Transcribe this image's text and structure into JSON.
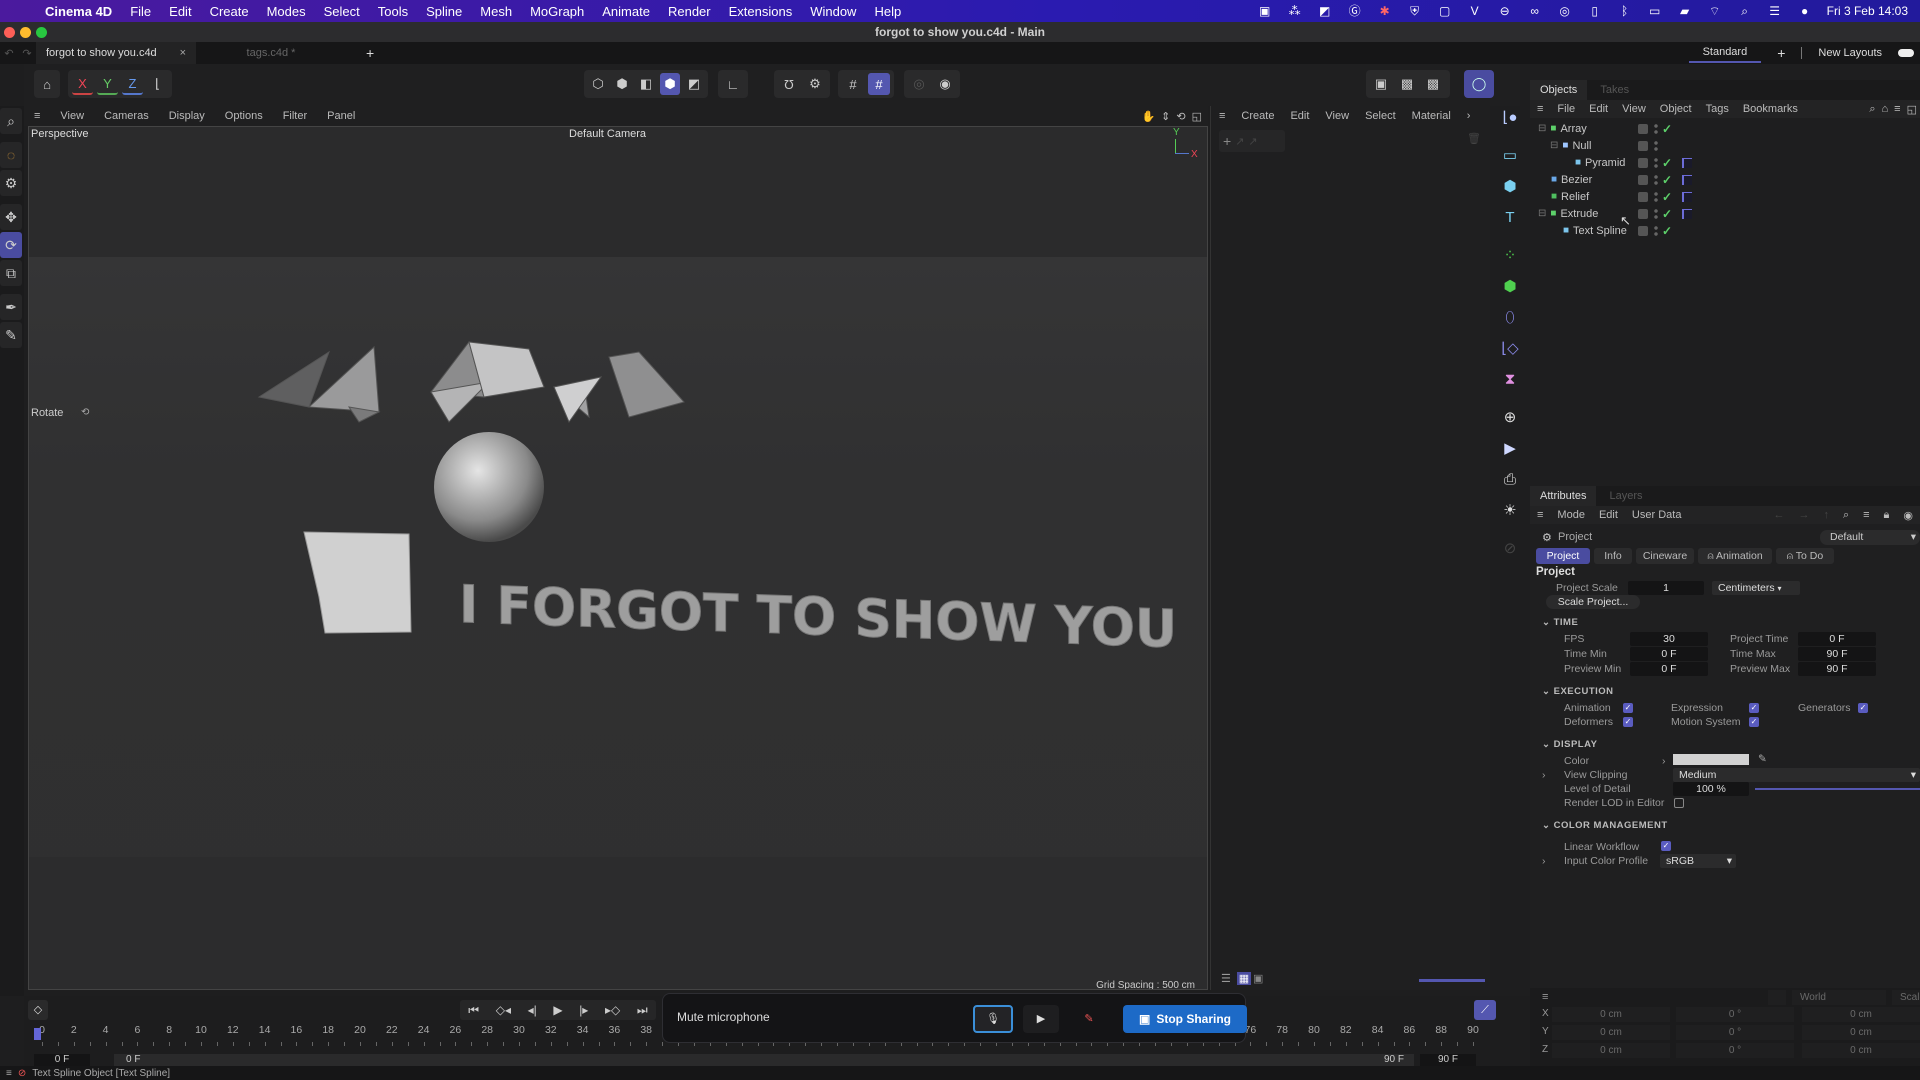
{
  "menubar": {
    "app_name": "Cinema 4D",
    "items": [
      "File",
      "Edit",
      "Create",
      "Modes",
      "Select",
      "Tools",
      "Spline",
      "Mesh",
      "MoGraph",
      "Animate",
      "Render",
      "Extensions",
      "Window",
      "Help"
    ],
    "clock": "Fri 3 Feb  14:03",
    "tray_icons": [
      "screen-record-icon",
      "people-icon",
      "dropbox-icon",
      "grammarly-icon",
      "dropbox-badge-icon",
      "vpn-icon",
      "display-icon",
      "v-icon",
      "teamviewer-icon",
      "creative-cloud-icon",
      "sync-icon",
      "battery-small-icon",
      "bluetooth-icon",
      "screen-mirror-icon",
      "battery-icon",
      "wifi-icon",
      "spotlight-icon",
      "control-center-icon",
      "siri-icon"
    ]
  },
  "window": {
    "title": "forgot to show you.c4d - Main"
  },
  "tabs": [
    {
      "label": "forgot to show you.c4d",
      "active": true
    },
    {
      "label": "tags.c4d *",
      "active": false
    }
  ],
  "new_tab_label": "+",
  "layouts": {
    "current": "Standard",
    "add": "+",
    "new_layouts": "New Layouts"
  },
  "viewport": {
    "menu": [
      "View",
      "Cameras",
      "Display",
      "Options",
      "Filter",
      "Panel"
    ],
    "view_name": "Perspective",
    "camera": "Default Camera",
    "tool_hint": "Rotate",
    "scene_text": "I FORGOT TO SHOW YOU",
    "grid_spacing": "Grid Spacing : 500 cm",
    "axis_labels": {
      "y": "Y",
      "x": "X"
    }
  },
  "axis_toggles": [
    "X",
    "Y",
    "Z"
  ],
  "material_panel": {
    "menu": [
      "Create",
      "Edit",
      "View",
      "Select",
      "Material"
    ],
    "more": "›"
  },
  "objects_panel": {
    "tabs": [
      {
        "label": "Objects",
        "active": true
      },
      {
        "label": "Takes",
        "active": false
      }
    ],
    "menu": [
      "File",
      "Edit",
      "View",
      "Object",
      "Tags",
      "Bookmarks"
    ],
    "objects": [
      {
        "name": "Array",
        "depth": 0,
        "icon": "array-icon",
        "expanded": true,
        "enabled": true,
        "tag": false,
        "color": "#5dd06a"
      },
      {
        "name": "Null",
        "depth": 1,
        "icon": "null-icon",
        "expanded": true,
        "enabled": false,
        "tag": false,
        "color": "#9fc6ff"
      },
      {
        "name": "Pyramid",
        "depth": 2,
        "icon": "pyramid-icon",
        "expanded": false,
        "enabled": true,
        "tag": true,
        "color": "#7cc5ec"
      },
      {
        "name": "Bezier",
        "depth": 0,
        "icon": "bezier-icon",
        "expanded": false,
        "enabled": true,
        "tag": true,
        "color": "#6aa8e8"
      },
      {
        "name": "Relief",
        "depth": 0,
        "icon": "relief-icon",
        "expanded": false,
        "enabled": true,
        "tag": true,
        "color": "#4fbf5f"
      },
      {
        "name": "Extrude",
        "depth": 0,
        "icon": "extrude-icon",
        "expanded": true,
        "enabled": true,
        "tag": true,
        "color": "#5dd06a"
      },
      {
        "name": "Text Spline",
        "depth": 1,
        "icon": "text-spline-icon",
        "expanded": false,
        "enabled": true,
        "tag": false,
        "color": "#7cc5ec"
      }
    ]
  },
  "attributes": {
    "tabs": [
      {
        "label": "Attributes",
        "active": true
      },
      {
        "label": "Layers",
        "active": false
      }
    ],
    "menu": [
      "Mode",
      "Edit",
      "User Data"
    ],
    "object_label": "Project",
    "preset": "Default",
    "subtabs": [
      {
        "label": "Project",
        "active": true
      },
      {
        "label": "Info",
        "active": false
      },
      {
        "label": "Cineware",
        "active": false
      },
      {
        "label": "Animation",
        "active": false,
        "icon": "bell-icon"
      },
      {
        "label": "To Do",
        "active": false,
        "icon": "bell-icon"
      }
    ],
    "section_title": "Project",
    "project_scale_label": "Project Scale",
    "project_scale": "1",
    "project_scale_unit": "Centimeters",
    "scale_project_button": "Scale Project...",
    "time": {
      "title": "TIME",
      "fps_label": "FPS",
      "fps": "30",
      "project_time_label": "Project Time",
      "project_time": "0 F",
      "time_min_label": "Time Min",
      "time_min": "0 F",
      "time_max_label": "Time Max",
      "time_max": "90 F",
      "preview_min_label": "Preview Min",
      "preview_min": "0 F",
      "preview_max_label": "Preview Max",
      "preview_max": "90 F"
    },
    "execution": {
      "title": "EXECUTION",
      "items": [
        {
          "label": "Animation",
          "checked": true
        },
        {
          "label": "Expression",
          "checked": true
        },
        {
          "label": "Generators",
          "checked": true
        },
        {
          "label": "Deformers",
          "checked": true
        },
        {
          "label": "Motion System",
          "checked": true
        }
      ]
    },
    "display": {
      "title": "DISPLAY",
      "color_label": "Color",
      "color_value": "#d2d2d2",
      "view_clipping_label": "View Clipping",
      "view_clipping": "Medium",
      "lod_label": "Level of Detail",
      "lod": "100 %",
      "lod_fraction": 1.0,
      "render_lod_label": "Render LOD in Editor",
      "render_lod": false
    },
    "color_management": {
      "title": "COLOR MANAGEMENT",
      "linear_workflow_label": "Linear Workflow",
      "linear_workflow": true,
      "input_profile_label": "Input Color Profile",
      "input_profile": "sRGB"
    }
  },
  "coordinates": {
    "space": "World",
    "mode": "Scale",
    "rows": [
      {
        "axis": "X",
        "pos": "0 cm",
        "rot": "0 °",
        "scale": "0 cm"
      },
      {
        "axis": "Y",
        "pos": "0 cm",
        "rot": "0 °",
        "scale": "0 cm"
      },
      {
        "axis": "Z",
        "pos": "0 cm",
        "rot": "0 °",
        "scale": "0 cm"
      }
    ]
  },
  "timeline": {
    "ticks": [
      "0",
      "2",
      "4",
      "6",
      "8",
      "10",
      "12",
      "14",
      "16",
      "18",
      "20",
      "22",
      "24",
      "26",
      "28",
      "30",
      "32",
      "34",
      "36",
      "38",
      "76",
      "78",
      "80",
      "82",
      "84",
      "86",
      "88",
      "90"
    ],
    "current_frame": "0 F",
    "range_start": "0 F",
    "range_end": "90 F",
    "max_frame": "90 F"
  },
  "sharing": {
    "tooltip": "Mute microphone",
    "stop_label": "Stop Sharing"
  },
  "status": {
    "text": "Text Spline Object [Text Spline]"
  },
  "colors": {
    "accent": "#4a4ca0",
    "check_green": "#5dd06a",
    "share_blue": "#1d6ac7"
  }
}
